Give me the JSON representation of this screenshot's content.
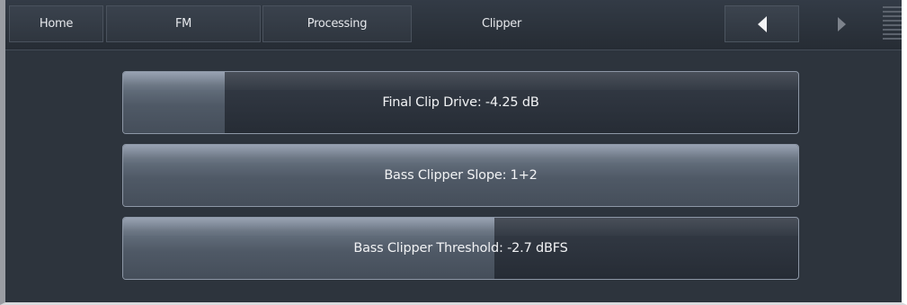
{
  "navbar": {
    "tabs": [
      {
        "label": "Home"
      },
      {
        "label": "FM"
      },
      {
        "label": "Processing"
      }
    ],
    "current_page": "Clipper",
    "back_icon": "triangle-left-icon",
    "forward_icon": "triangle-right-icon",
    "menu_icon": "hamburger-menu-icon"
  },
  "parameters": [
    {
      "label": "Final Clip Drive: -4.25 dB",
      "fill_fraction": 0.15
    },
    {
      "label": "Bass Clipper Slope: 1+2",
      "fill_fraction": 1.0
    },
    {
      "label": "Bass Clipper Threshold: -2.7 dBFS",
      "fill_fraction": 0.55
    }
  ],
  "colors": {
    "background": "#2d343d",
    "slider_fill": "#66717f",
    "text": "#f1f2f4"
  }
}
